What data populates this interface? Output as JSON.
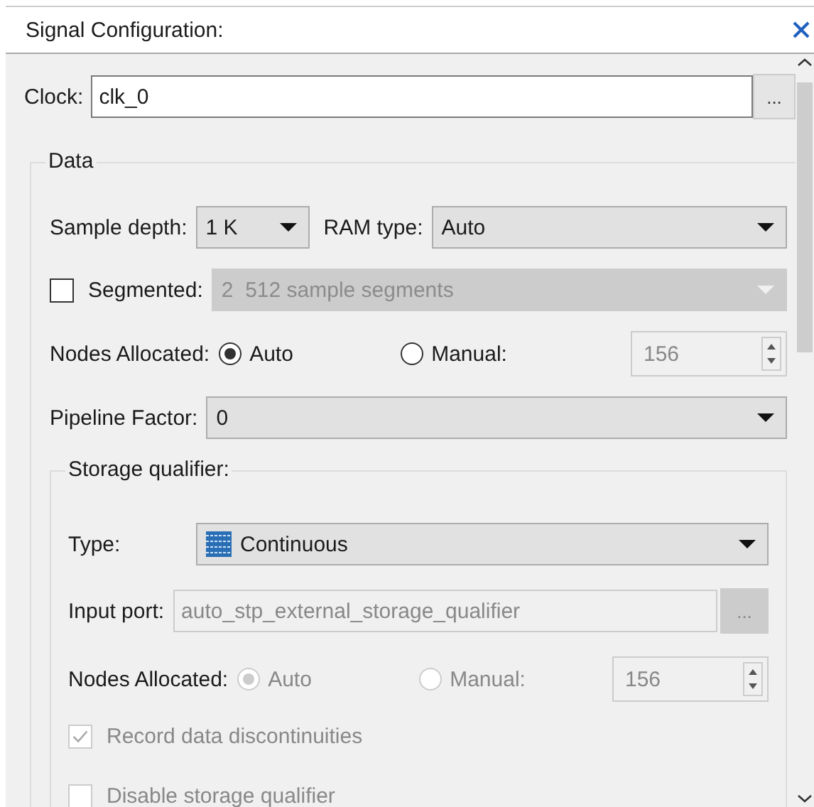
{
  "panel": {
    "title": "Signal Configuration:"
  },
  "clock": {
    "label": "Clock:",
    "value": "clk_0",
    "browse": "..."
  },
  "data": {
    "title": "Data",
    "sample_depth": {
      "label": "Sample depth:",
      "value": "1 K"
    },
    "ram_type": {
      "label": "RAM type:",
      "value": "Auto"
    },
    "segmented": {
      "label": "Segmented:",
      "checked": false,
      "value": "2  512 sample segments",
      "disabled": true
    },
    "nodes": {
      "label": "Nodes Allocated:",
      "disabled": false,
      "options": [
        {
          "label": "Auto",
          "selected": true
        },
        {
          "label": "Manual:",
          "selected": false
        }
      ],
      "count": "156"
    },
    "pipeline": {
      "label": "Pipeline Factor:",
      "value": "0"
    }
  },
  "storage": {
    "title": "Storage qualifier:",
    "type": {
      "label": "Type:",
      "value": "Continuous"
    },
    "input_port": {
      "label": "Input port:",
      "value": "auto_stp_external_storage_qualifier",
      "disabled": true,
      "browse": "..."
    },
    "nodes": {
      "label": "Nodes Allocated:",
      "disabled": true,
      "options": [
        {
          "label": "Auto",
          "selected": true
        },
        {
          "label": "Manual:",
          "selected": false
        }
      ],
      "count": "156"
    },
    "checks": [
      {
        "label": "Record data discontinuities",
        "checked": true,
        "disabled": true
      },
      {
        "label": "Disable storage qualifier",
        "checked": false,
        "disabled": true
      }
    ]
  }
}
